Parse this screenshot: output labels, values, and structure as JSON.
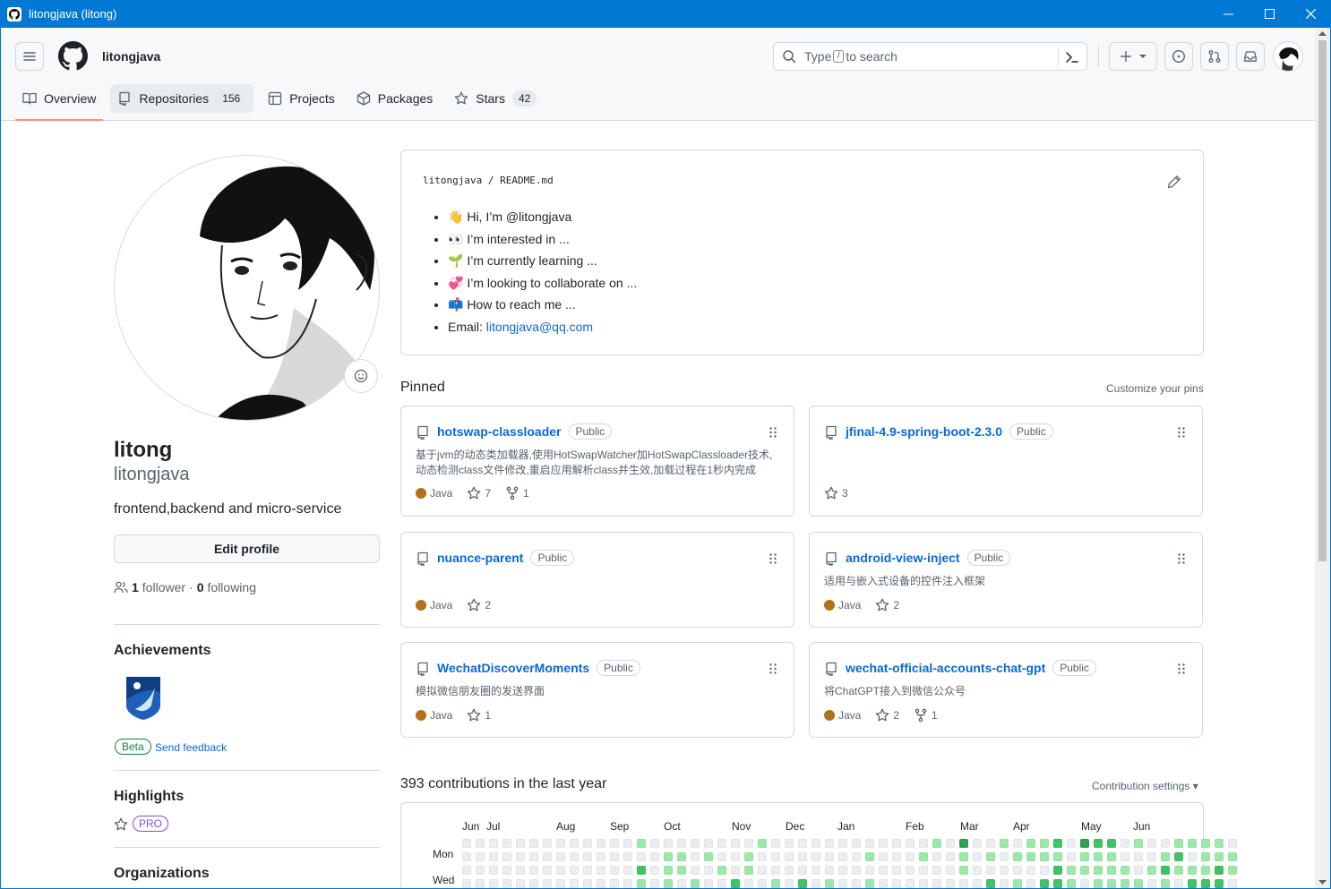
{
  "window": {
    "title": "litongjava (litong)"
  },
  "header": {
    "username": "litongjava",
    "search_type": "Type",
    "search_key": "/",
    "search_rest": "to search"
  },
  "tabs": [
    {
      "label": "Overview"
    },
    {
      "label": "Repositories",
      "count": "156"
    },
    {
      "label": "Projects"
    },
    {
      "label": "Packages"
    },
    {
      "label": "Stars",
      "count": "42"
    }
  ],
  "profile": {
    "name": "litong",
    "login": "litongjava",
    "bio": "frontend,backend and micro-service",
    "edit_label": "Edit profile",
    "followers_count": "1",
    "followers_label": "follower",
    "following_count": "0",
    "following_label": "following"
  },
  "achievements": {
    "title": "Achievements",
    "beta": "Beta",
    "feedback": "Send feedback"
  },
  "highlights": {
    "title": "Highlights",
    "pro": "PRO"
  },
  "organizations": {
    "title": "Organizations"
  },
  "readme": {
    "owner": "litongjava",
    "file": "README.md",
    "items": [
      {
        "emoji": "👋",
        "text": "Hi, I’m @litongjava"
      },
      {
        "emoji": "👀",
        "text": "I’m interested in ..."
      },
      {
        "emoji": "🌱",
        "text": "I’m currently learning ..."
      },
      {
        "emoji": "💞️",
        "text": "I’m looking to collaborate on ..."
      },
      {
        "emoji": "📫",
        "text": "How to reach me ..."
      }
    ],
    "email_label": "Email:",
    "email": "litongjava@qq.com"
  },
  "pinned": {
    "title": "Pinned",
    "customize": "Customize your pins",
    "badge": "Public",
    "repos": [
      {
        "name": "hotswap-classloader",
        "desc": "基于jvm的动态类加载器,使用HotSwapWatcher加HotSwapClassloader技术,动态检测class文件修改,重启应用解析class并生效,加载过程在1秒内完成",
        "lang": "Java",
        "stars": "7",
        "forks": "1"
      },
      {
        "name": "jfinal-4.9-spring-boot-2.3.0",
        "desc": "",
        "lang": "",
        "stars": "3",
        "forks": ""
      },
      {
        "name": "nuance-parent",
        "desc": "",
        "lang": "Java",
        "stars": "2",
        "forks": ""
      },
      {
        "name": "android-view-inject",
        "desc": "适用与嵌入式设备的控件注入框架",
        "lang": "Java",
        "stars": "2",
        "forks": ""
      },
      {
        "name": "WechatDiscoverMoments",
        "desc": "模拟微信朋友圈的发送界面",
        "lang": "Java",
        "stars": "1",
        "forks": ""
      },
      {
        "name": "wechat-official-accounts-chat-gpt",
        "desc": "将ChatGPT接入到微信公众号",
        "lang": "Java",
        "stars": "2",
        "forks": "1"
      }
    ]
  },
  "contributions": {
    "title": "393 contributions in the last year",
    "settings": "Contribution settings ▾",
    "months": [
      "Jun",
      "Jul",
      "Aug",
      "Sep",
      "Oct",
      "Nov",
      "Dec",
      "Jan",
      "Feb",
      "Mar",
      "Apr",
      "May",
      "Jun"
    ],
    "weekdays": [
      "Mon",
      "Wed"
    ],
    "colors": [
      "#ebedf0",
      "#9be9a8",
      "#40c463",
      "#30a14e"
    ],
    "grid": [
      "0000000000000100000000100000000000010300101120322010011110",
      "0000000000000001101001000000001000100101011110111000120111",
      "0000000000000201100101000000000000000100000021111101211121",
      "0000000000000101010020010201001000000002010221011110102220"
    ]
  }
}
